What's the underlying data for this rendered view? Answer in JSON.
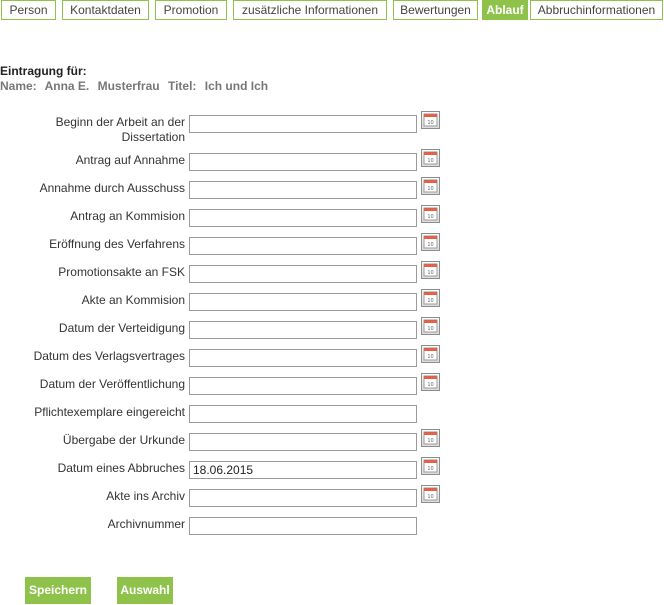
{
  "tabs": [
    {
      "label": "Person",
      "active": false
    },
    {
      "label": "Kontaktdaten",
      "active": false
    },
    {
      "label": "Promotion",
      "active": false
    },
    {
      "label": "zusätzliche Informationen",
      "active": false
    },
    {
      "label": "Bewertungen",
      "active": false
    },
    {
      "label": "Ablauf",
      "active": true
    },
    {
      "label": "Abbruchinformationen",
      "active": false
    }
  ],
  "entry": {
    "title": "Eintragung für:",
    "name_label": "Name:",
    "name_value": "Anna E.",
    "surname_value": "Musterfrau",
    "title_label": "Titel:",
    "title_value": "Ich und Ich"
  },
  "fields": [
    {
      "label_line1": "Beginn der Arbeit an der",
      "label_line2": "Dissertation",
      "value": "",
      "has_calendar": true
    },
    {
      "label_line1": "Antrag auf Annahme",
      "label_line2": "",
      "value": "",
      "has_calendar": true
    },
    {
      "label_line1": "Annahme durch Ausschuss",
      "label_line2": "",
      "value": "",
      "has_calendar": true
    },
    {
      "label_line1": "Antrag an Kommision",
      "label_line2": "",
      "value": "",
      "has_calendar": true
    },
    {
      "label_line1": "Eröffnung des Verfahrens",
      "label_line2": "",
      "value": "",
      "has_calendar": true
    },
    {
      "label_line1": "Promotionsakte an FSK",
      "label_line2": "",
      "value": "",
      "has_calendar": true
    },
    {
      "label_line1": "Akte an Kommision",
      "label_line2": "",
      "value": "",
      "has_calendar": true
    },
    {
      "label_line1": "Datum der Verteidigung",
      "label_line2": "",
      "value": "",
      "has_calendar": true
    },
    {
      "label_line1": "Datum des Verlagsvertrages",
      "label_line2": "",
      "value": "",
      "has_calendar": true
    },
    {
      "label_line1": "Datum der Veröffentlichung",
      "label_line2": "",
      "value": "",
      "has_calendar": true
    },
    {
      "label_line1": "Pflichtexemplare eingereicht",
      "label_line2": "",
      "value": "",
      "has_calendar": false
    },
    {
      "label_line1": "Übergabe der Urkunde",
      "label_line2": "",
      "value": "",
      "has_calendar": true
    },
    {
      "label_line1": "Datum eines Abbruches",
      "label_line2": "",
      "value": "18.06.2015",
      "has_calendar": true
    },
    {
      "label_line1": "Akte ins Archiv",
      "label_line2": "",
      "value": "",
      "has_calendar": true
    },
    {
      "label_line1": "Archivnummer",
      "label_line2": "",
      "value": "",
      "has_calendar": false
    }
  ],
  "calendar_icon": "calendar-icon",
  "buttons": {
    "save": "Speichern",
    "select": "Auswahl"
  },
  "colors": {
    "accent": "#8fc24b"
  }
}
